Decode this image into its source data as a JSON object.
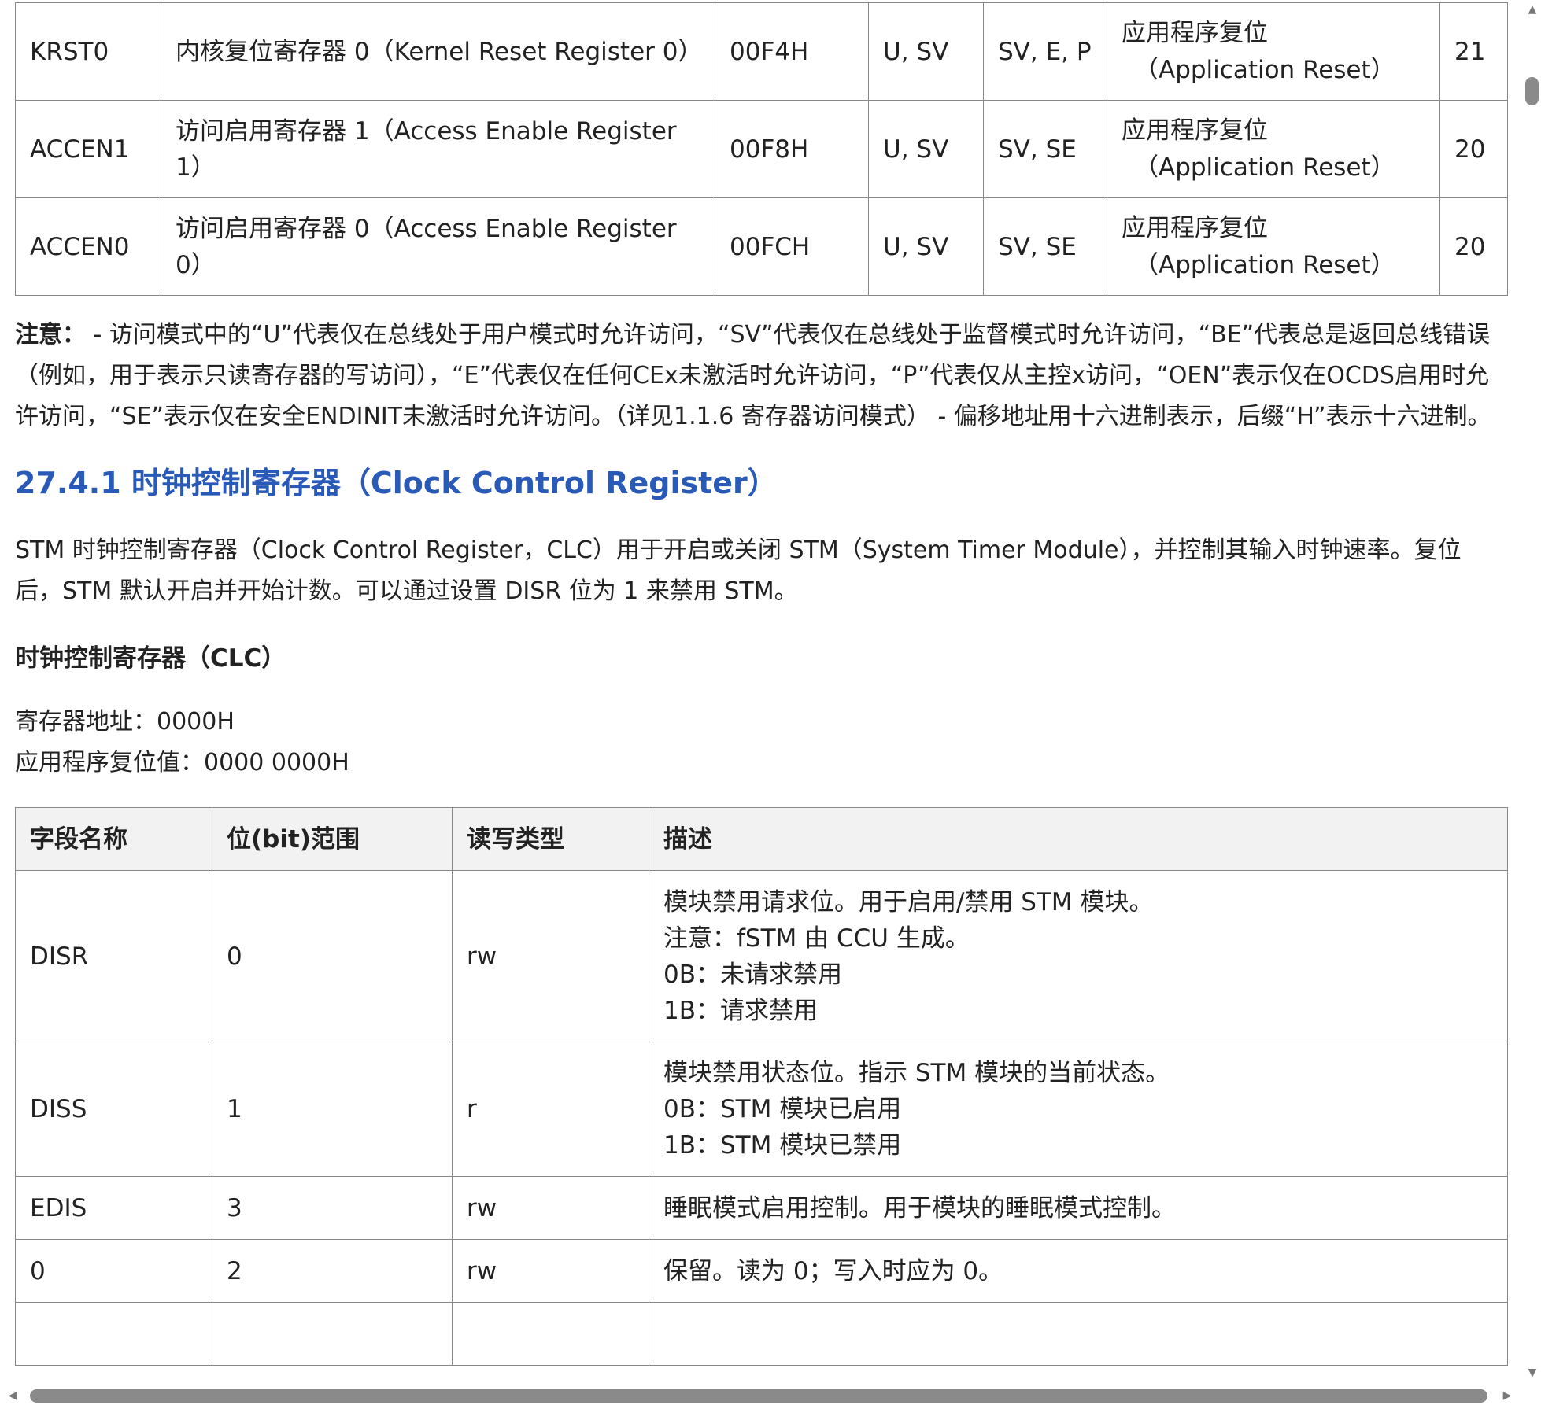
{
  "register_table": {
    "rows": [
      {
        "name": "KRST0",
        "desc": "内核复位寄存器 0（Kernel Reset Register 0）",
        "offset": "00F4H",
        "read_access": "U, SV",
        "write_access": "SV, E, P",
        "reset_line1": "应用程序复位",
        "reset_line2": "（Application Reset）",
        "page": "21"
      },
      {
        "name": "ACCEN1",
        "desc": "访问启用寄存器 1（Access Enable Register 1）",
        "offset": "00F8H",
        "read_access": "U, SV",
        "write_access": "SV, SE",
        "reset_line1": "应用程序复位",
        "reset_line2": "（Application Reset）",
        "page": "20"
      },
      {
        "name": "ACCEN0",
        "desc": "访问启用寄存器 0（Access Enable Register 0）",
        "offset": "00FCH",
        "read_access": "U, SV",
        "write_access": "SV, SE",
        "reset_line1": "应用程序复位",
        "reset_line2": "（Application Reset）",
        "page": "20"
      }
    ]
  },
  "note": {
    "label": "注意：",
    "text": " - 访问模式中的“U”代表仅在总线处于用户模式时允许访问，“SV”代表仅在总线处于监督模式时允许访问，“BE”代表总是返回总线错误（例如，用于表示只读寄存器的写访问），“E”代表仅在任何CEx未激活时允许访问，“P”代表仅从主控x访问，“OEN”表示仅在OCDS启用时允许访问，“SE”表示仅在安全ENDINIT未激活时允许访问。（详见1.1.6 寄存器访问模式） - 偏移地址用十六进制表示，后缀“H”表示十六进制。"
  },
  "section": {
    "heading": "27.4.1 时钟控制寄存器（Clock Control Register）",
    "intro": "STM 时钟控制寄存器（Clock Control Register，CLC）用于开启或关闭 STM（System Timer Module），并控制其输入时钟速率。复位后，STM 默认开启并开始计数。可以通过设置 DISR 位为 1 来禁用 STM。",
    "register_title": "时钟控制寄存器（CLC）",
    "address_line": "寄存器地址：0000H",
    "reset_value_line": "应用程序复位值：0000 0000H"
  },
  "field_table": {
    "headers": [
      "字段名称",
      "位(bit)范围",
      "读写类型",
      "描述"
    ],
    "rows": [
      {
        "field": "DISR",
        "bits": "0",
        "access": "rw",
        "desc": [
          "模块禁用请求位。用于启用/禁用 STM 模块。",
          "注意：fSTM 由 CCU 生成。",
          "0B：未请求禁用",
          "1B：请求禁用"
        ]
      },
      {
        "field": "DISS",
        "bits": "1",
        "access": "r",
        "desc": [
          "模块禁用状态位。指示 STM 模块的当前状态。",
          "0B：STM 模块已启用",
          "1B：STM 模块已禁用"
        ]
      },
      {
        "field": "EDIS",
        "bits": "3",
        "access": "rw",
        "desc": [
          "睡眠模式启用控制。用于模块的睡眠模式控制。"
        ]
      },
      {
        "field": "0",
        "bits": "2",
        "access": "rw",
        "desc": [
          "保留。读为 0；写入时应为 0。"
        ]
      }
    ]
  },
  "colors": {
    "heading": "#2a5ab8",
    "border": "#888888",
    "header_bg": "#f2f2f2",
    "scrollbar": "#8a8a8a"
  },
  "icons": {
    "scroll_up": "▲",
    "scroll_down": "▼",
    "scroll_left": "◀",
    "scroll_right": "▶"
  }
}
